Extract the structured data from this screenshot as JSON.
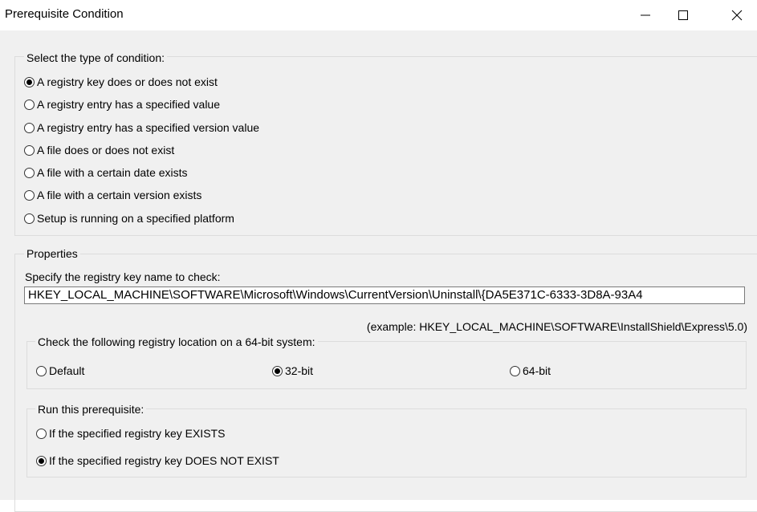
{
  "window": {
    "title": "Prerequisite Condition",
    "minimize_glyph": "—",
    "close_glyph": "✕"
  },
  "condition_group": {
    "label": "Select the type of condition:",
    "options": [
      "A registry key does or does not exist",
      "A registry entry has a specified value",
      "A registry entry has a specified version value",
      "A file does or does not exist",
      "A file with a certain date exists",
      "A file with a certain version exists",
      "Setup is running on a specified platform"
    ],
    "selected_index": 0
  },
  "properties_group": {
    "label": "Properties",
    "key_prompt": "Specify the registry key name to check:",
    "key_value": "HKEY_LOCAL_MACHINE\\SOFTWARE\\Microsoft\\Windows\\CurrentVersion\\Uninstall\\{DA5E371C-6333-3D8A-93A4",
    "example": "(example: HKEY_LOCAL_MACHINE\\SOFTWARE\\InstallShield\\Express\\5.0)"
  },
  "location_group": {
    "label": "Check the following registry location on a 64-bit system:",
    "options": [
      "Default",
      "32-bit",
      "64-bit"
    ],
    "selected_index": 1
  },
  "run_group": {
    "label": "Run this prerequisite:",
    "options": [
      "If the specified registry key EXISTS",
      "If the specified registry key DOES NOT EXIST"
    ],
    "selected_index": 1
  }
}
